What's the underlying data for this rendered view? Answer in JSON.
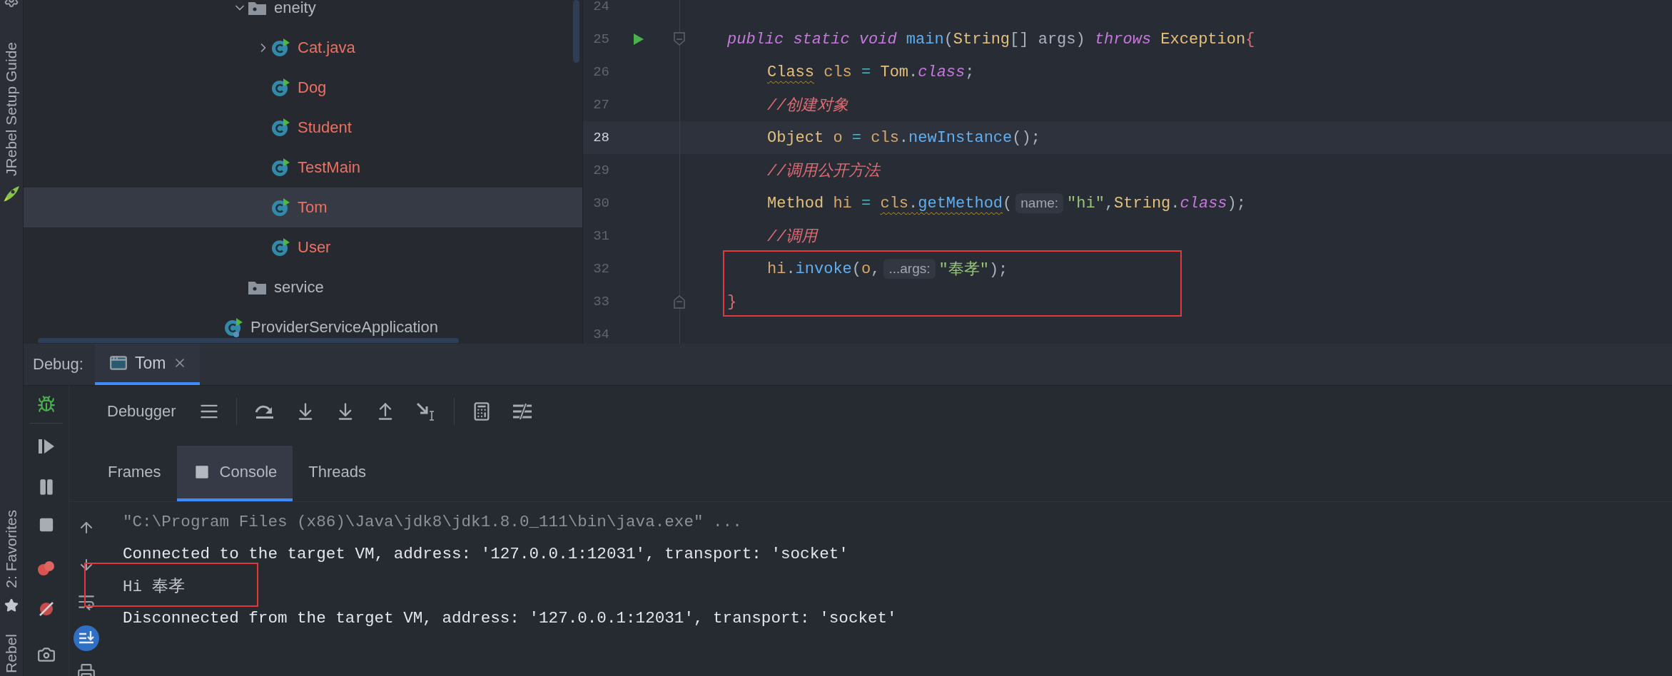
{
  "side_toolbar": {
    "top_label": "JRebel Setup Guide",
    "favorites_label": "2: Favorites",
    "bottom_label": "Rebel"
  },
  "project_tree": [
    {
      "kind": "group",
      "children": [
        {
          "label": "eneity",
          "kind": "folder",
          "expanded": true,
          "selected": false,
          "children": [
            {
              "label": "Cat.java",
              "kind": "class",
              "expanded": false,
              "selected": false
            },
            {
              "label": "Dog",
              "kind": "class",
              "selected": false
            },
            {
              "label": "Student",
              "kind": "class",
              "selected": false
            },
            {
              "label": "TestMain",
              "kind": "class",
              "selected": false
            },
            {
              "label": "Tom",
              "kind": "class",
              "selected": true
            },
            {
              "label": "User",
              "kind": "class",
              "selected": false
            }
          ]
        },
        {
          "label": "service",
          "kind": "folder",
          "selected": false
        }
      ]
    },
    {
      "label": "ProviderServiceApplication",
      "kind": "app",
      "selected": false
    }
  ],
  "editor": {
    "highlight_box": true,
    "lines": [
      {
        "number": "24",
        "current": false
      },
      {
        "number": "25",
        "current": false,
        "run": true,
        "fold_start": true,
        "segments": [
          {
            "kind": "code",
            "tokens": [
              {
                "text": "public static void ",
                "kind": "keyword"
              },
              {
                "text": "main",
                "kind": "method"
              },
              {
                "text": "(",
                "kind": "plain"
              },
              {
                "text": "String",
                "kind": "type"
              },
              {
                "text": "[] args) ",
                "kind": "plain"
              },
              {
                "text": "throws ",
                "kind": "keyword"
              },
              {
                "text": "Exception",
                "kind": "type"
              },
              {
                "text": "{",
                "kind": "brace"
              }
            ]
          }
        ],
        "children": [
          {
            "number": "26",
            "current": false,
            "segments": [
              {
                "kind": "flagged",
                "tokens": [
                  {
                    "text": "Class",
                    "kind": "type"
                  }
                ]
              },
              {
                "kind": "code",
                "tokens": [
                  {
                    "text": " cls",
                    "kind": "variable"
                  },
                  {
                    "text": " = ",
                    "kind": "operator"
                  },
                  {
                    "text": "Tom",
                    "kind": "type"
                  },
                  {
                    "text": ".",
                    "kind": "plain"
                  },
                  {
                    "text": "class",
                    "kind": "keyword"
                  },
                  {
                    "text": ";",
                    "kind": "plain"
                  }
                ]
              }
            ]
          },
          {
            "number": "27",
            "current": false,
            "segments": [
              {
                "kind": "code",
                "tokens": [
                  {
                    "text": "//创建对象",
                    "kind": "comment"
                  }
                ]
              }
            ]
          },
          {
            "number": "28",
            "current": true,
            "segments": [
              {
                "kind": "code",
                "tokens": [
                  {
                    "text": "Object",
                    "kind": "type"
                  },
                  {
                    "text": " o",
                    "kind": "variable"
                  },
                  {
                    "text": " = ",
                    "kind": "operator"
                  },
                  {
                    "text": "cls",
                    "kind": "variable"
                  },
                  {
                    "text": ".",
                    "kind": "plain"
                  },
                  {
                    "text": "newInstance",
                    "kind": "method"
                  },
                  {
                    "text": "();",
                    "kind": "plain"
                  }
                ]
              }
            ]
          },
          {
            "number": "29",
            "current": false,
            "segments": [
              {
                "kind": "code",
                "tokens": [
                  {
                    "text": "//调用公开方法",
                    "kind": "comment"
                  }
                ]
              }
            ]
          },
          {
            "number": "30",
            "current": false,
            "segments": [
              {
                "kind": "code",
                "tokens": [
                  {
                    "text": "Method",
                    "kind": "type"
                  },
                  {
                    "text": " hi",
                    "kind": "variable"
                  },
                  {
                    "text": " = ",
                    "kind": "operator"
                  }
                ]
              },
              {
                "kind": "flagged",
                "tokens": [
                  {
                    "text": "cls",
                    "kind": "variable"
                  },
                  {
                    "text": ".",
                    "kind": "plain"
                  },
                  {
                    "text": "getMethod",
                    "kind": "method"
                  }
                ]
              },
              {
                "kind": "code",
                "tokens": [
                  {
                    "text": "(",
                    "kind": "plain"
                  }
                ]
              },
              {
                "kind": "hint",
                "text": "name:"
              },
              {
                "kind": "code",
                "tokens": [
                  {
                    "text": "\"hi\"",
                    "kind": "string"
                  },
                  {
                    "text": ",",
                    "kind": "plain"
                  },
                  {
                    "text": "String",
                    "kind": "type"
                  },
                  {
                    "text": ".",
                    "kind": "plain"
                  },
                  {
                    "text": "class",
                    "kind": "keyword"
                  },
                  {
                    "text": ");",
                    "kind": "plain"
                  }
                ]
              }
            ]
          },
          {
            "number": "31",
            "current": false,
            "segments": [
              {
                "kind": "code",
                "tokens": [
                  {
                    "text": "//调用",
                    "kind": "comment"
                  }
                ]
              }
            ]
          },
          {
            "number": "32",
            "current": false,
            "segments": [
              {
                "kind": "code",
                "tokens": [
                  {
                    "text": "hi",
                    "kind": "variable"
                  },
                  {
                    "text": ".",
                    "kind": "plain"
                  },
                  {
                    "text": "invoke",
                    "kind": "method"
                  },
                  {
                    "text": "(",
                    "kind": "plain"
                  },
                  {
                    "text": "o",
                    "kind": "variable"
                  },
                  {
                    "text": ",",
                    "kind": "plain"
                  }
                ]
              },
              {
                "kind": "hint",
                "text": "...args:"
              },
              {
                "kind": "code",
                "tokens": [
                  {
                    "text": "\"奉孝\"",
                    "kind": "string"
                  },
                  {
                    "text": ");",
                    "kind": "plain"
                  }
                ]
              }
            ]
          }
        ]
      },
      {
        "number": "33",
        "current": false,
        "fold_end": true,
        "segments": [
          {
            "kind": "code",
            "tokens": [
              {
                "text": "}",
                "kind": "brace"
              }
            ]
          }
        ]
      },
      {
        "number": "34",
        "current": false
      }
    ]
  },
  "debug": {
    "label": "Debug:",
    "tabs": [
      {
        "label": "Tom",
        "selected": true
      }
    ],
    "toolbar_label": "Debugger",
    "subtabs": [
      {
        "label": "Frames",
        "selected": false
      },
      {
        "label": "Console",
        "selected": true
      },
      {
        "label": "Threads",
        "selected": false
      }
    ],
    "console": {
      "highlight_box": true,
      "lines": [
        {
          "text": "\"C:\\Program Files (x86)\\Java\\jdk8\\jdk1.8.0_111\\bin\\java.exe\" ...",
          "kind": "command"
        },
        {
          "text": "Connected to the target VM, address: '127.0.0.1:12031', transport: 'socket'",
          "kind": "system"
        },
        {
          "text": "Hi 奉孝",
          "kind": "output"
        },
        {
          "text": "Disconnected from the target VM, address: '127.0.0.1:12031', transport: 'socket'",
          "kind": "system"
        }
      ]
    }
  }
}
